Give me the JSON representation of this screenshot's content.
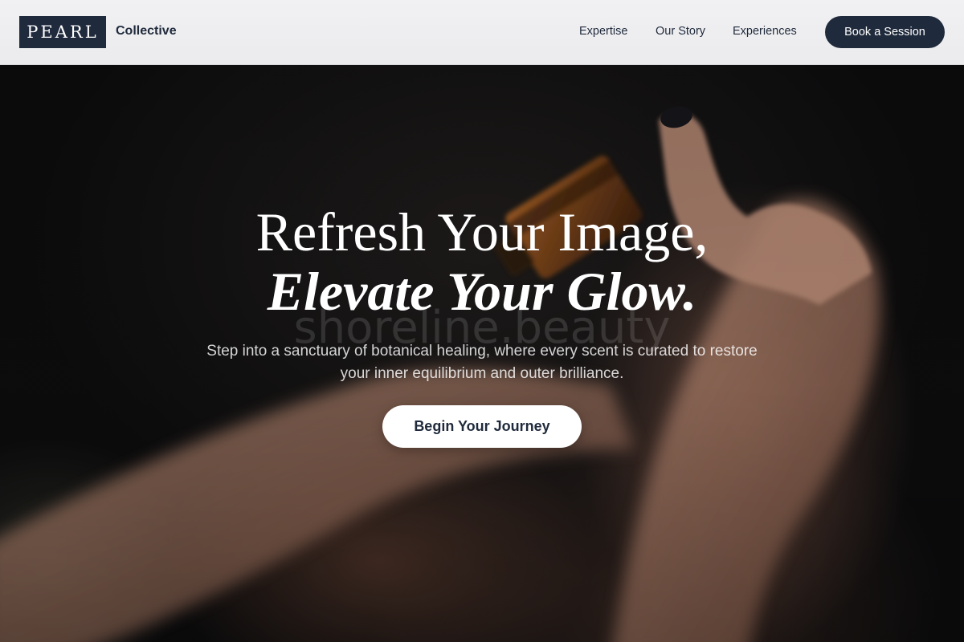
{
  "header": {
    "logo_text": "PEARL",
    "logo_suffix": "Collective",
    "nav": [
      {
        "label": "Expertise"
      },
      {
        "label": "Our Story"
      },
      {
        "label": "Experiences"
      }
    ],
    "cta_label": "Book a Session"
  },
  "hero": {
    "headline_line1": "Refresh Your Image,",
    "headline_line2": "Elevate Your Glow.",
    "watermark": "shoreline.beauty",
    "subtext": "Step into a sanctuary of botanical healing, where every scent is curated to restore your inner equilibrium and outer brilliance.",
    "button_label": "Begin Your Journey",
    "background_image": "hand-holding-amber-essential-oil-bottle"
  },
  "colors": {
    "brand_navy": "#1f2a3c",
    "header_bg": "#eeeef0",
    "hero_text": "#ffffff",
    "button_bg": "#ffffff"
  }
}
